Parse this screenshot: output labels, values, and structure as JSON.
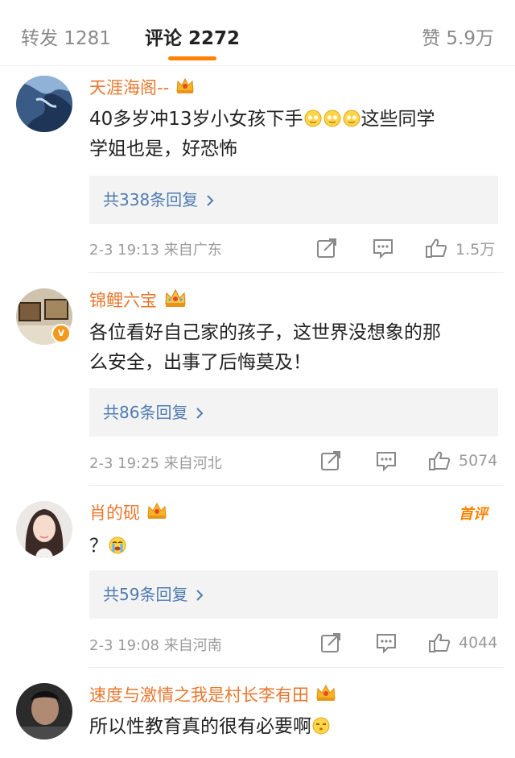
{
  "tabs": {
    "repost": "转发 1281",
    "comments": "评论 2272",
    "likes": "赞 5.9万"
  },
  "colors": {
    "accent": "#ff8200",
    "username": "#e8772e",
    "reply_link": "#4f7cb0"
  },
  "comments": [
    {
      "username": "天涯海阁--",
      "text_line1": "40多岁冲13岁小女孩下手",
      "text_line1_tail": "这些同学",
      "text_line2": "学姐也是，好恐怖",
      "replies": "共338条回复",
      "meta": "2-3 19:13  来自广东",
      "likes": "1.5万"
    },
    {
      "username": "锦鲤六宝",
      "text_line1": "各位看好自己家的孩子，这世界没想象的那",
      "text_line2": "么安全，出事了后悔莫及！",
      "replies": "共86条回复",
      "meta": "2-3 19:25  来自河北",
      "likes": "5074",
      "verified_mark": "v"
    },
    {
      "username": "肖的砚",
      "badge": "首评",
      "text_line1": "？",
      "replies": "共59条回复",
      "meta": "2-3 19:08  来自河南",
      "likes": "4044"
    },
    {
      "username": "速度与激情之我是村长李有田",
      "text_line1": "所以性教育真的很有必要啊"
    }
  ]
}
